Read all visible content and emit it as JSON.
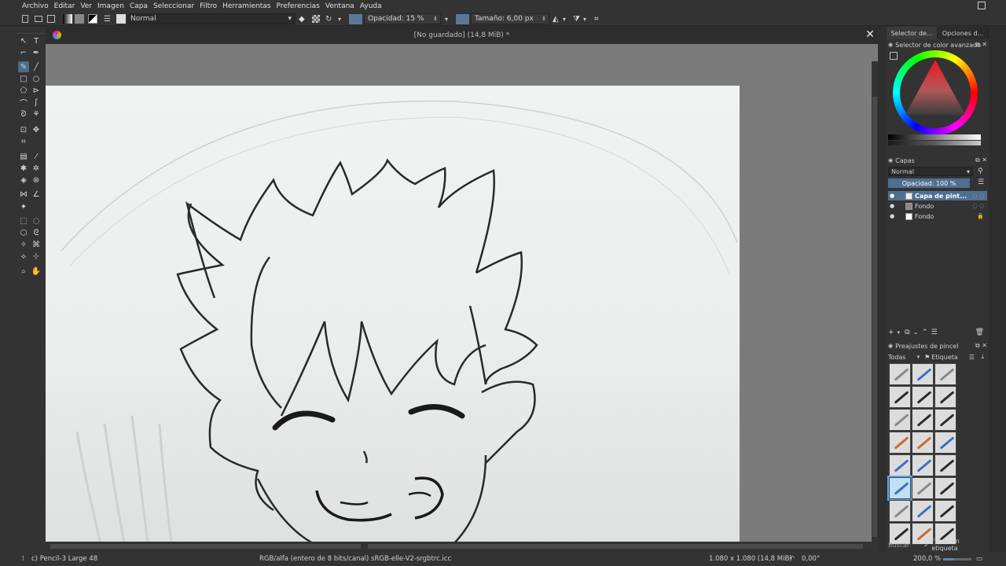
{
  "menubar": {
    "items": [
      "Archivo",
      "Editar",
      "Ver",
      "Imagen",
      "Capa",
      "Seleccionar",
      "Filtro",
      "Herramientas",
      "Preferencias",
      "Ventana",
      "Ayuda"
    ]
  },
  "tool_options": {
    "blend_mode": "Normal",
    "opacity": "Opacidad: 15 %",
    "size": "Tamaño: 6,00 px"
  },
  "document": {
    "title": "[No guardado]  (14,8 MiB) *"
  },
  "dock": {
    "tabs": [
      "Selector de...",
      "Opciones d..."
    ],
    "color_panel_title": "Selector de color avanzado",
    "layers_panel_title": "Capas",
    "layers_blend": "Normal",
    "layers_opacity": "Opacidad:  100 %",
    "layers": [
      {
        "name": "Capa de pint...",
        "active": true
      },
      {
        "name": "Fondo",
        "active": false
      },
      {
        "name": "Fondo",
        "active": false
      }
    ],
    "brush_panel_title": "Preajustes de pincel",
    "brush_filter": "Todas",
    "brush_tag": "Etiqueta",
    "brush_search_placeholder": "Buscar",
    "brush_filter_check": "Filtrar en etiqueta"
  },
  "statusbar": {
    "brush": "c) Pencil-3 Large 48",
    "color_profile": "RGB/alfa (entero de 8 bits/canal)  sRGB-elle-V2-srgbtrc.icc",
    "dimensions": "1.080 x 1.080 (14,8 MiB)",
    "rotation": "0,00°",
    "zoom": "200,0 %"
  }
}
